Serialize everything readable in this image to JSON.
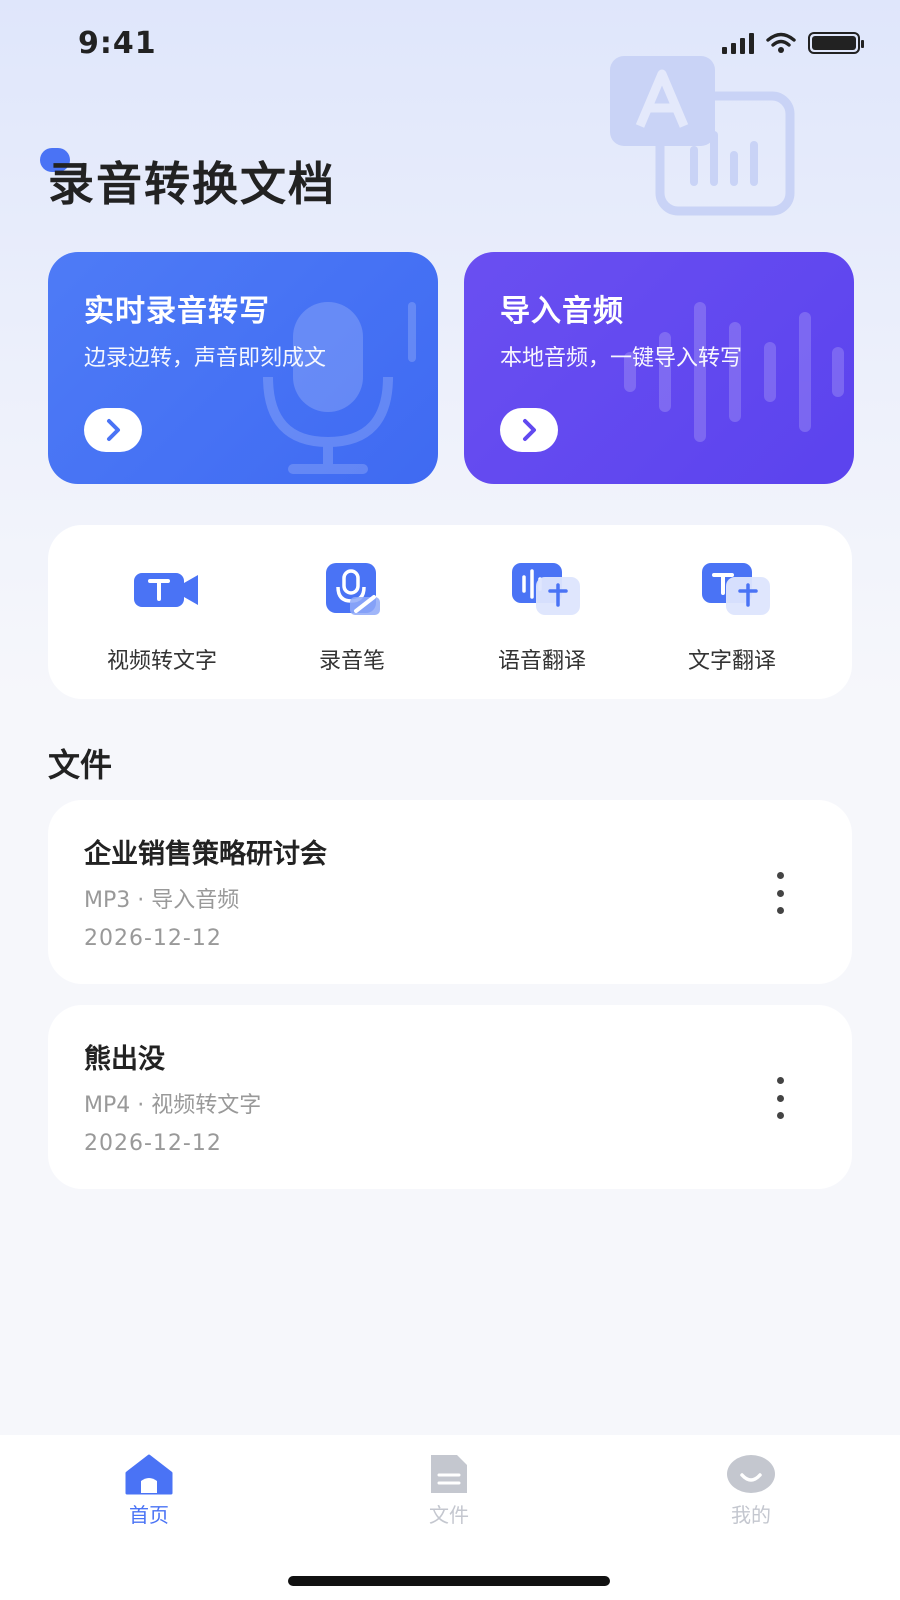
{
  "status": {
    "time": "9:41"
  },
  "header": {
    "title": "录音转换文档"
  },
  "cards": [
    {
      "title": "实时录音转写",
      "subtitle": "边录边转，声音即刻成文",
      "color": "#4a73f5"
    },
    {
      "title": "导入音频",
      "subtitle": "本地音频，一键导入转写",
      "color": "#6149f0"
    }
  ],
  "tools": [
    {
      "label": "视频转文字",
      "icon": "video-text-icon"
    },
    {
      "label": "录音笔",
      "icon": "recorder-pen-icon"
    },
    {
      "label": "语音翻译",
      "icon": "voice-translate-icon"
    },
    {
      "label": "文字翻译",
      "icon": "text-translate-icon"
    }
  ],
  "files_section": {
    "title": "文件"
  },
  "files": [
    {
      "name": "企业销售策略研讨会",
      "meta": "MP3 · 导入音频",
      "date": "2026-12-12"
    },
    {
      "name": "熊出没",
      "meta": "MP4 · 视频转文字",
      "date": "2026-12-12"
    }
  ],
  "tabbar": {
    "items": [
      {
        "label": "首页",
        "icon": "home-icon",
        "active": true
      },
      {
        "label": "文件",
        "icon": "document-icon",
        "active": false
      },
      {
        "label": "我的",
        "icon": "profile-icon",
        "active": false
      }
    ],
    "active_color": "#4a73f5",
    "inactive_color": "#c4c7cf"
  }
}
